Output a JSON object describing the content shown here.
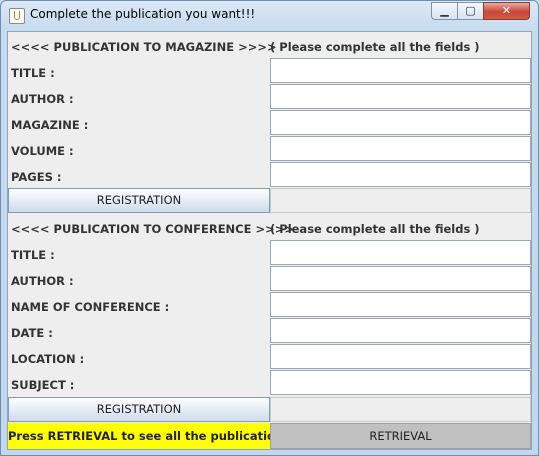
{
  "window": {
    "title": "Complete the publication you want!!!",
    "controls": {
      "minimize": "▁",
      "maximize": "▢",
      "close": "✕"
    }
  },
  "magazine": {
    "header": "<<<< PUBLICATION TO MAGAZINE >>>>",
    "note": "( Please complete all the fields )",
    "fields": [
      {
        "label": "TITLE :",
        "value": ""
      },
      {
        "label": "AUTHOR :",
        "value": ""
      },
      {
        "label": "MAGAZINE :",
        "value": ""
      },
      {
        "label": "VOLUME :",
        "value": ""
      },
      {
        "label": "PAGES :",
        "value": ""
      }
    ],
    "button": "REGISTRATION"
  },
  "conference": {
    "header": "<<<< PUBLICATION TO CONFERENCE >>>>",
    "note": "( Please complete all the fields )",
    "fields": [
      {
        "label": "TITLE :",
        "value": ""
      },
      {
        "label": "AUTHOR :",
        "value": ""
      },
      {
        "label": "NAME OF CONFERENCE :",
        "value": ""
      },
      {
        "label": "DATE :",
        "value": ""
      },
      {
        "label": "LOCATION :",
        "value": ""
      },
      {
        "label": "SUBJECT :",
        "value": ""
      }
    ],
    "button": "REGISTRATION"
  },
  "footer": {
    "hint": "Press RETRIEVAL to see all the publications!!!",
    "retrieval": "RETRIEVAL"
  },
  "colors": {
    "hint_bg": "#ffff00",
    "retrieval_bg": "#c0c0c0",
    "panel_bg": "#eeeeee"
  }
}
